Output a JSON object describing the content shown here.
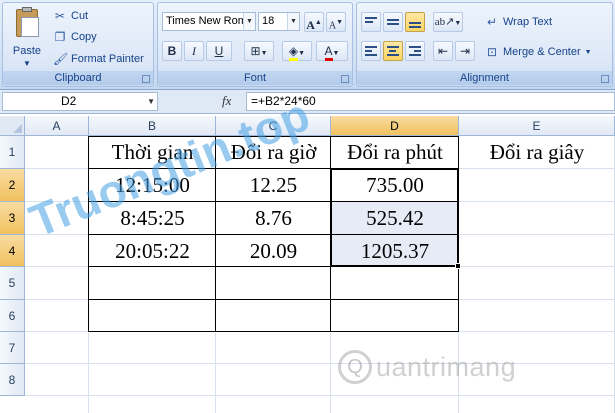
{
  "ribbon": {
    "clipboard": {
      "paste_label": "Paste",
      "cut_label": "Cut",
      "copy_label": "Copy",
      "format_painter_label": "Format Painter",
      "group_label": "Clipboard"
    },
    "font": {
      "font_name": "Times New Rom",
      "font_size": "18",
      "grow_label": "A",
      "shrink_label": "A",
      "bold_label": "B",
      "italic_label": "I",
      "underline_label": "U",
      "font_color_label": "A",
      "group_label": "Font"
    },
    "alignment": {
      "wrap_text_label": "Wrap Text",
      "merge_center_label": "Merge & Center",
      "group_label": "Alignment"
    }
  },
  "formula_bar": {
    "name_box": "D2",
    "fx_label": "fx",
    "formula": "=+B2*24*60"
  },
  "sheet": {
    "columns": [
      "A",
      "B",
      "C",
      "D",
      "E"
    ],
    "rows": [
      "1",
      "2",
      "3",
      "4",
      "5",
      "6",
      "7",
      "8"
    ],
    "header_row": [
      "Thời gian",
      "Đổi ra giờ",
      "Đổi ra phút",
      "Đổi ra giây"
    ],
    "data_rows": [
      [
        "12:15:00",
        "12.25",
        "735.00",
        ""
      ],
      [
        "8:45:25",
        "8.76",
        "525.42",
        ""
      ],
      [
        "20:05:22",
        "20.09",
        "1205.37",
        ""
      ],
      [
        "",
        "",
        "",
        ""
      ],
      [
        "",
        "",
        "",
        ""
      ]
    ],
    "selection_color": "#e6ebf6",
    "header_highlight_color": "#f6cc74"
  },
  "watermarks": {
    "logo_text": "Truongtin.top",
    "brand_text": "uantrimang",
    "brand_glyph": "Q"
  }
}
